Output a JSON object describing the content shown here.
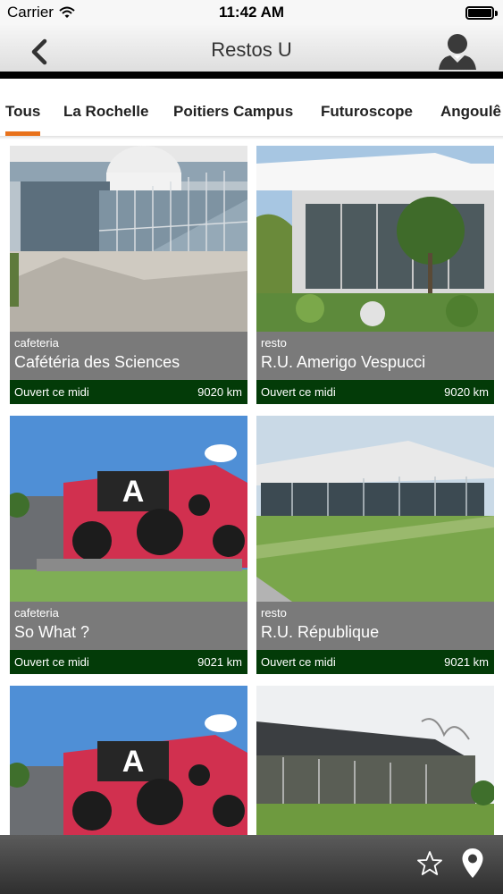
{
  "status_bar": {
    "carrier": "Carrier",
    "time": "11:42 AM"
  },
  "nav": {
    "title": "Restos U",
    "icons": {
      "back": "back-chevron-icon",
      "account": "user-icon"
    }
  },
  "tabs": [
    {
      "label": "Tous",
      "active": true
    },
    {
      "label": "La Rochelle",
      "active": false
    },
    {
      "label": "Poitiers Campus",
      "active": false
    },
    {
      "label": "Futuroscope",
      "active": false
    },
    {
      "label": "Angoulê",
      "active": false
    }
  ],
  "accent_color": "#e8721c",
  "status_color": "#033b08",
  "restaurants": [
    {
      "category": "cafeteria",
      "name": "Cafétéria des Sciences",
      "status": "Ouvert ce midi",
      "distance": "9020 km"
    },
    {
      "category": "resto",
      "name": "R.U. Amerigo Vespucci",
      "status": "Ouvert ce midi",
      "distance": "9020 km"
    },
    {
      "category": "cafeteria",
      "name": "So What ?",
      "status": "Ouvert ce midi",
      "distance": "9021 km"
    },
    {
      "category": "resto",
      "name": "R.U. République",
      "status": "Ouvert ce midi",
      "distance": "9021 km"
    }
  ],
  "toolbar": {
    "icons": [
      "star-icon",
      "location-pin-icon"
    ]
  }
}
